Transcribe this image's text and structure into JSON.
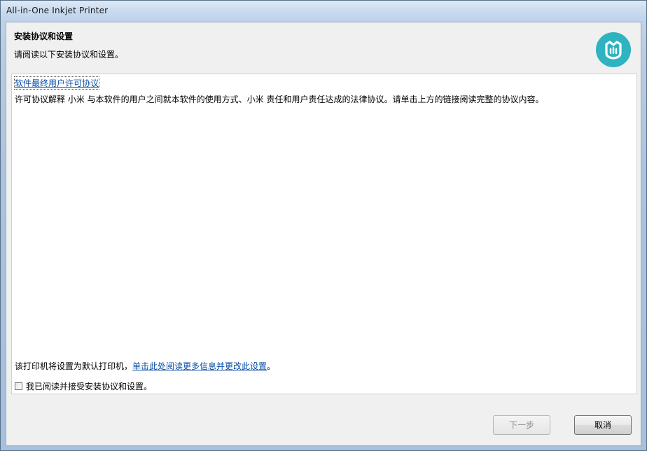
{
  "window": {
    "title": "All-in-One Inkjet Printer"
  },
  "header": {
    "title": "安装协议和设置",
    "subtitle": "请阅读以下安装协议和设置。",
    "logo_icon": "mi-home-logo-icon",
    "logo_color": "#2fb3c0"
  },
  "agreement": {
    "link_label": "软件最终用户许可协议",
    "description": "许可协议解释 小米 与本软件的用户之间就本软件的使用方式、小米 责任和用户责任达成的法律协议。请单击上方的链接阅读完整的协议内容。"
  },
  "default_printer": {
    "prefix": "该打印机将设置为默认打印机，",
    "link_label": "单击此处阅读更多信息并更改此设置",
    "suffix": "。"
  },
  "accept": {
    "label": "我已阅读并接受安装协议和设置。",
    "checked": false
  },
  "buttons": {
    "next_label": "下一步",
    "next_enabled": false,
    "cancel_label": "取消"
  }
}
